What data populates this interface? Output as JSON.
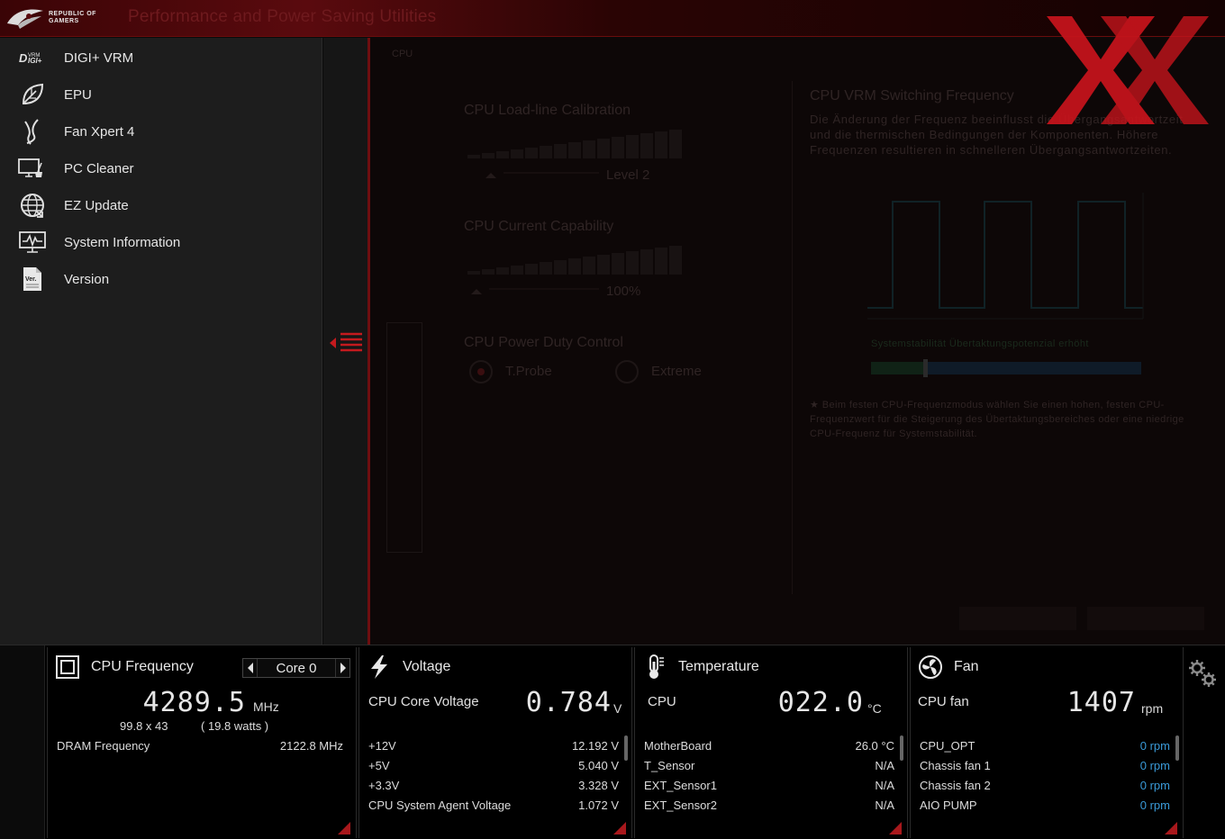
{
  "app": {
    "brand": "REPUBLIC OF\nGAMERS",
    "title": "Performance and Power Saving Utilities"
  },
  "sidebar": {
    "items": [
      {
        "label": "DIGI+ VRM",
        "icon": "digi-icon"
      },
      {
        "label": "EPU",
        "icon": "leaf-icon"
      },
      {
        "label": "Fan Xpert 4",
        "icon": "fan-blade-icon"
      },
      {
        "label": "PC Cleaner",
        "icon": "pc-cleaner-icon"
      },
      {
        "label": "EZ Update",
        "icon": "globe-icon"
      },
      {
        "label": "System Information",
        "icon": "monitor-chart-icon"
      },
      {
        "label": "Version",
        "icon": "document-icon"
      }
    ]
  },
  "main": {
    "subtab": "CPU",
    "llc": {
      "title": "CPU Load-line Calibration",
      "value": "Level 2"
    },
    "ccc": {
      "title": "CPU Current Capability",
      "value": "100%"
    },
    "pdc": {
      "title": "CPU Power Duty Control",
      "options": [
        "T.Probe",
        "Extreme"
      ],
      "selected": "T.Probe"
    },
    "vrm": {
      "title": "CPU VRM Switching Frequency",
      "description": "Die Änderung der Frequenz beeinflusst die Übergangsantwortzeit und die thermischen Bedingungen der Komponenten. Höhere Frequenzen resultieren in schnelleren Übergangsantwortzeiten.",
      "stability_label": "Systemstabilität Übertaktungspotenzial erhöht",
      "slider_level": 0.2,
      "note": "★ Beim festen CPU-Frequenzmodus wählen Sie einen hohen, festen CPU-Frequenzwert für die Steigerung des Übertaktungsbereiches oder eine niedrige CPU-Frequenz für Systemstabilität."
    }
  },
  "monitor": {
    "cpu": {
      "title": "CPU Frequency",
      "core": "Core 0",
      "frequency": "4289.5",
      "unit": "MHz",
      "ratio": "99.8 x 43",
      "power": "( 19.8 watts )",
      "dram_label": "DRAM Frequency",
      "dram_value": "2122.8 MHz"
    },
    "voltage": {
      "title": "Voltage",
      "main_label": "CPU Core Voltage",
      "main_value": "0.784",
      "main_unit": "V",
      "rows": [
        {
          "label": "+12V",
          "value": "12.192 V"
        },
        {
          "label": "+5V",
          "value": "5.040 V"
        },
        {
          "label": "+3.3V",
          "value": "3.328 V"
        },
        {
          "label": "CPU System Agent Voltage",
          "value": "1.072 V"
        }
      ]
    },
    "temperature": {
      "title": "Temperature",
      "main_label": "CPU",
      "main_value": "022.0",
      "main_unit": "°C",
      "rows": [
        {
          "label": "MotherBoard",
          "value": "26.0 °C"
        },
        {
          "label": "T_Sensor",
          "value": "N/A"
        },
        {
          "label": "EXT_Sensor1",
          "value": "N/A"
        },
        {
          "label": "EXT_Sensor2",
          "value": "N/A"
        }
      ]
    },
    "fan": {
      "title": "Fan",
      "main_label": "CPU fan",
      "main_value": "1407",
      "main_unit": "rpm",
      "rows": [
        {
          "label": "CPU_OPT",
          "value": "0 rpm"
        },
        {
          "label": "Chassis fan 1",
          "value": "0 rpm"
        },
        {
          "label": "Chassis fan 2",
          "value": "0 rpm"
        },
        {
          "label": "AIO PUMP",
          "value": "0 rpm"
        }
      ]
    }
  },
  "colors": {
    "accent": "#a8181c",
    "rpm": "#3a9ad8",
    "watermark": "#c8141c"
  }
}
